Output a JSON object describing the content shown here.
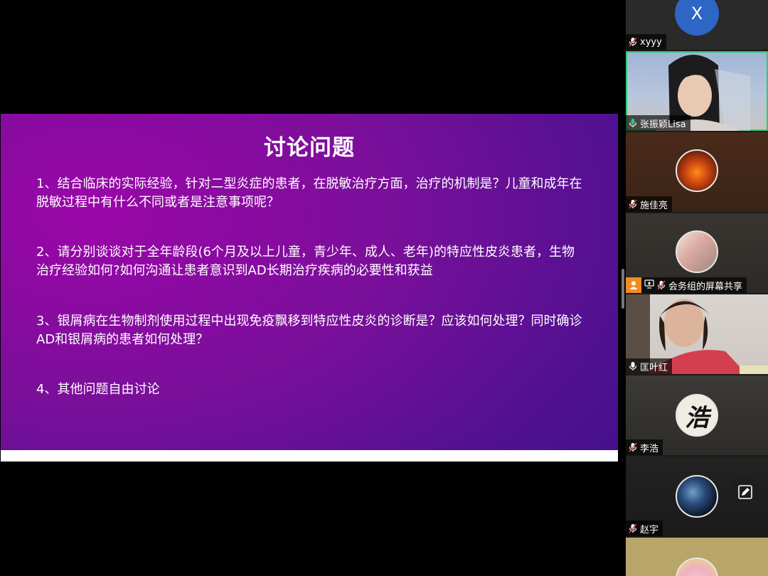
{
  "slide": {
    "title": "讨论问题",
    "questions": [
      "1、结合临床的实际经验，针对二型炎症的患者，在脱敏治疗方面，治疗的机制是？儿童和成年在脱敏过程中有什么不同或者是注意事项呢？",
      "2、请分别谈谈对于全年龄段(6个月及以上儿童，青少年、成人、老年)的特应性皮炎患者，生物治疗经验如何?如何沟通让患者意识到AD长期治疗疾病的必要性和获益",
      "3、银屑病在生物制剂使用过程中出现免疫飘移到特应性皮炎的诊断是？应该如何处理？同时确诊AD和银屑病的患者如何处理？",
      "4、其他问题自由讨论"
    ]
  },
  "participants": [
    {
      "name": "xyyy",
      "avatar_letter": "X",
      "mic": "muted"
    },
    {
      "name": "张振颖Lisa",
      "mic": "on",
      "active": true
    },
    {
      "name": "施佳亮",
      "mic": "muted"
    },
    {
      "name": "会务组的屏幕共享",
      "mic": "muted",
      "host": true,
      "sharing": true
    },
    {
      "name": "匡叶红",
      "mic": "on"
    },
    {
      "name": "李浩",
      "mic": "muted",
      "avatar_char": "浩"
    },
    {
      "name": "赵宇",
      "mic": "muted"
    }
  ],
  "colors": {
    "active_border": "#2ecc71",
    "avatar_blue": "#2e66c6",
    "host_orange": "#f58a1f",
    "mic_muted": "#e0433b"
  },
  "icons": {
    "mic_muted": "mic-muted-icon",
    "mic_on": "mic-icon",
    "host": "person-icon",
    "share": "screen-share-icon",
    "float": "edit-icon"
  }
}
